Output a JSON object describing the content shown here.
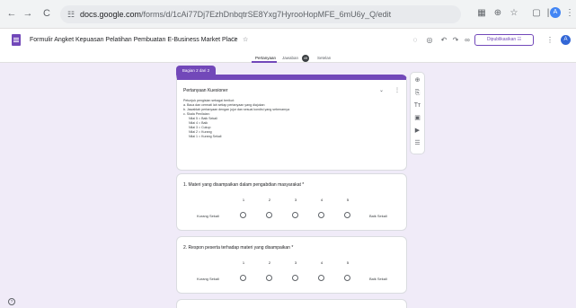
{
  "browser": {
    "nav": {
      "back": "←",
      "forward": "→",
      "reload": "C"
    },
    "site_icon": "tune-icon",
    "url_host": "docs.google.com",
    "url_path": "/forms/d/1cAi77Dj7EzhDnbqtrSE8Yxg7HyrooHopMFE_6mU6y_Q/edit",
    "right_icons": [
      "translate-icon",
      "zoom-icon",
      "star-icon",
      "extensions-icon"
    ],
    "profile_initial": "A"
  },
  "app": {
    "title": "Formulir Angket Kepuasan Pelatihan Pembuatan E-Business Market Place",
    "folder_icon": "□",
    "star_icon": "☆",
    "tools": {
      "palette": "◌",
      "preview": "◎",
      "undo": "↶",
      "redo": "↷",
      "link": "∞",
      "add_collaborator": "⁺"
    },
    "publish_label": "Dipublikasikan ☷",
    "more": "⋮",
    "avatar_initial": "A"
  },
  "tabs": {
    "questions": "Pertanyaan",
    "responses": "Jawaban",
    "responses_count": "49",
    "settings": "Setelan"
  },
  "section": {
    "label": "Bagian 2 dari 2",
    "title": "Pertanyaan Kuesioner",
    "collapse": "⌄",
    "menu": "⋮",
    "description": [
      "Petunjuk pengisian sebagai berikut:",
      "a. Baca dan cermati lah setiap pertanyaan yang diajukan",
      "b. Jawablah pertanyaan dengan jujur dan sesuai kondisi yang sebenarnya",
      "c. Skala Penilaian:",
      "   Nilai 5 = Baik Sekali",
      "   Nilai 4 = Baik",
      "   Nilai 3 = Cukup",
      "   Nilai 2 = Kurang",
      "   Nilai 1 = Kurang Sekali"
    ]
  },
  "questions": [
    {
      "title": "1. Materi yang disampaikan dalam pengabdian masyarakat *",
      "scale": [
        "1",
        "2",
        "3",
        "4",
        "5"
      ],
      "low_label": "Kurang Sekali",
      "high_label": "Baik Sekali"
    },
    {
      "title": "2. Respon peserta terhadap materi yang disampaikan *",
      "scale": [
        "1",
        "2",
        "3",
        "4",
        "5"
      ],
      "low_label": "Kurang Sekali",
      "high_label": "Baik Sekali"
    }
  ],
  "toolbar": {
    "add_question": "⊕",
    "import_questions": "⎘",
    "add_title": "Tт",
    "add_image": "▣",
    "add_video": "▶",
    "add_section": "☰"
  },
  "help": "?",
  "colors": {
    "accent": "#7248b9",
    "background": "#f0ebf8"
  }
}
